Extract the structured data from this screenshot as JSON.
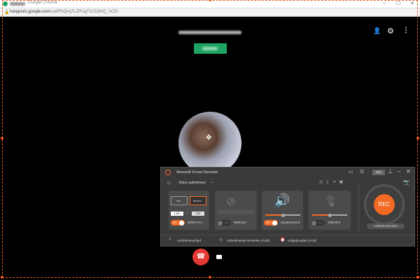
{
  "browser": {
    "title": "Google Chrome",
    "url_host": "hangouts.google.com",
    "url_path": "/call/FkQnq7LZPUgTt1OQthQ_ACEI"
  },
  "call": {
    "end_call_color": "#e53935",
    "join_button_color": "#1ea362"
  },
  "recorder": {
    "app_title": "Aiseesoft Screen Recorder",
    "mini_label": "Mini",
    "mode_label": "Video aufnehmen",
    "display": {
      "full_label": "Voll",
      "region_label": "Bereich",
      "width": "1490",
      "height": "996",
      "toggle": "EIN",
      "display_name": "DISPLAY1"
    },
    "webcam": {
      "toggle": "AUS",
      "label": "Webcam"
    },
    "system_sound": {
      "toggle": "EIN",
      "label": "Systemsound",
      "volume_percent": 45
    },
    "microphone": {
      "toggle": "AUS",
      "label": "Mikrofon",
      "volume_percent": 45
    },
    "rec_label": "REC",
    "record_mode_label": "Aufnahmemodus",
    "footer": {
      "history": "Aufnahmeverlauf",
      "timer": "Aufnahmezeit einstellen (AUS)",
      "schedule": "Aufgabenplan (AUS)"
    },
    "accent": "#f26a24"
  }
}
